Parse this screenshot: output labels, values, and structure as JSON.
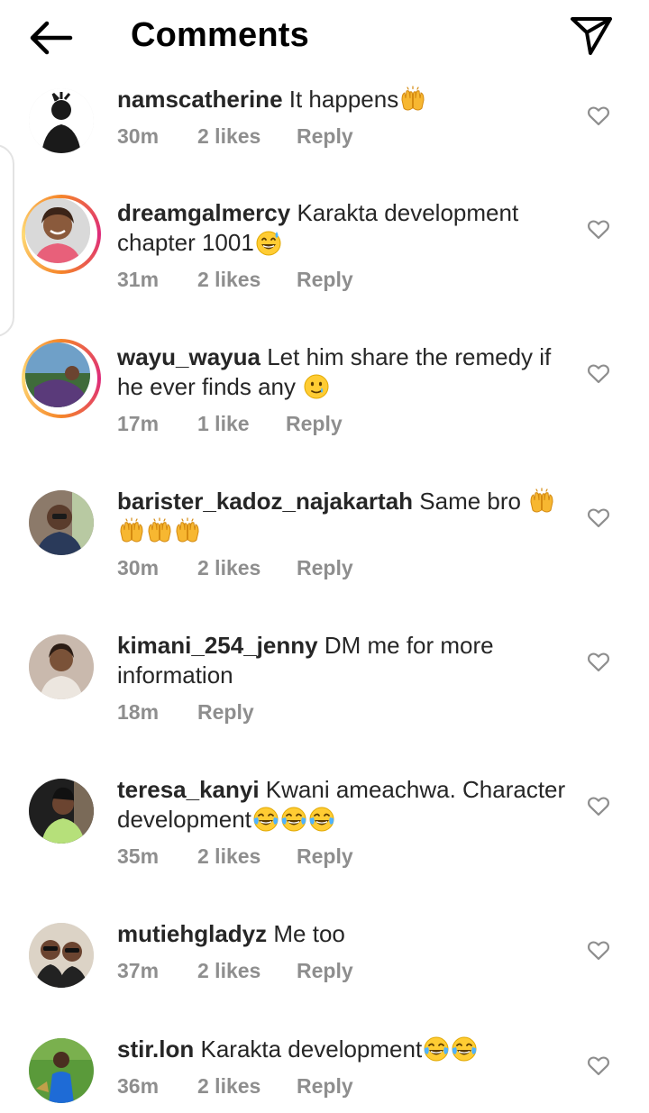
{
  "header": {
    "title": "Comments",
    "back_icon": "arrow-left-icon",
    "send_icon": "paper-plane-icon"
  },
  "colors": {
    "text": "#262626",
    "meta": "#8e8e8e",
    "story_ring_start": "#f58529",
    "story_ring_end": "#dd2a7b"
  },
  "comments": [
    {
      "username": "namscatherine",
      "text": "It happens",
      "emoji": [
        "raising-hands"
      ],
      "time": "30m",
      "likes": "2 likes",
      "reply": "Reply",
      "story_ring": false
    },
    {
      "username": "dreamgalmercy",
      "text": "Karakta development chapter 1001",
      "emoji": [
        "grinning-sweat"
      ],
      "time": "31m",
      "likes": "2 likes",
      "reply": "Reply",
      "story_ring": true
    },
    {
      "username": "wayu_wayua",
      "text": "Let him share the remedy if he ever finds any ",
      "emoji": [
        "smiling-with-tear"
      ],
      "time": "17m",
      "likes": "1 like",
      "reply": "Reply",
      "story_ring": true
    },
    {
      "username": "barister_kadoz_najakartah",
      "text": "Same bro ",
      "emoji": [
        "raising-hands",
        "raising-hands",
        "raising-hands",
        "raising-hands"
      ],
      "time": "30m",
      "likes": "2 likes",
      "reply": "Reply",
      "story_ring": false
    },
    {
      "username": "kimani_254_jenny",
      "text": "DM me for more information",
      "emoji": [],
      "time": "18m",
      "likes": "",
      "reply": "Reply",
      "story_ring": false
    },
    {
      "username": "teresa_kanyi",
      "text": "Kwani ameachwa. Character development",
      "emoji": [
        "tears-of-joy",
        "tears-of-joy",
        "tears-of-joy"
      ],
      "time": "35m",
      "likes": "2 likes",
      "reply": "Reply",
      "story_ring": false
    },
    {
      "username": "mutiehgladyz",
      "text": "Me too",
      "emoji": [],
      "time": "37m",
      "likes": "2 likes",
      "reply": "Reply",
      "story_ring": false
    },
    {
      "username": "stir.lon",
      "text": "Karakta development",
      "emoji": [
        "tears-of-joy",
        "tears-of-joy"
      ],
      "time": "36m",
      "likes": "2 likes",
      "reply": "Reply",
      "story_ring": false
    }
  ]
}
